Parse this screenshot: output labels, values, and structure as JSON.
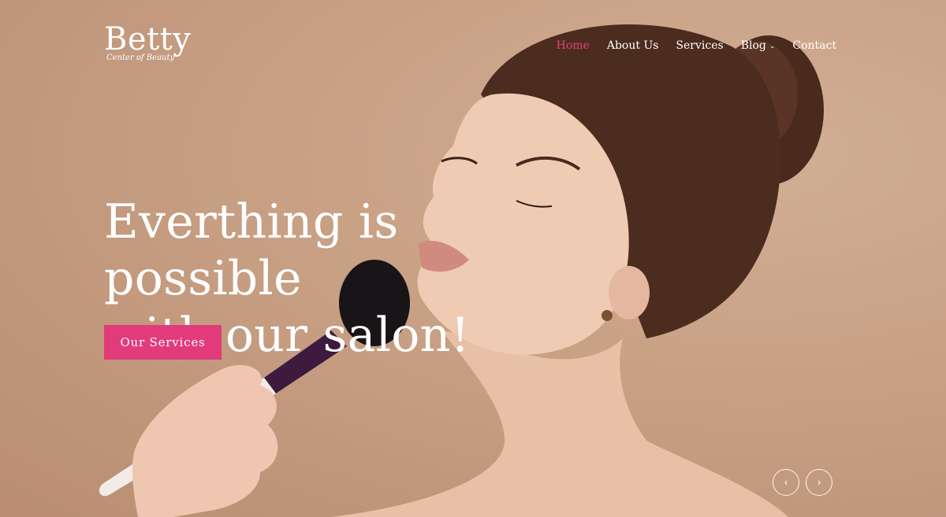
{
  "brand": {
    "name": "Betty",
    "tagline": "Center of Beauty"
  },
  "nav": {
    "home": "Home",
    "about": "About Us",
    "services": "Services",
    "blog": "Blog",
    "contact": "Contact"
  },
  "hero": {
    "headline_line1": "Everthing is possible",
    "headline_line2": "with our salon!",
    "cta": "Our Services"
  },
  "slider": {
    "prev_icon": "‹",
    "next_icon": "›"
  },
  "colors": {
    "accent": "#e23b7b",
    "nav_active": "#e33f7e",
    "background": "#c69f84"
  }
}
